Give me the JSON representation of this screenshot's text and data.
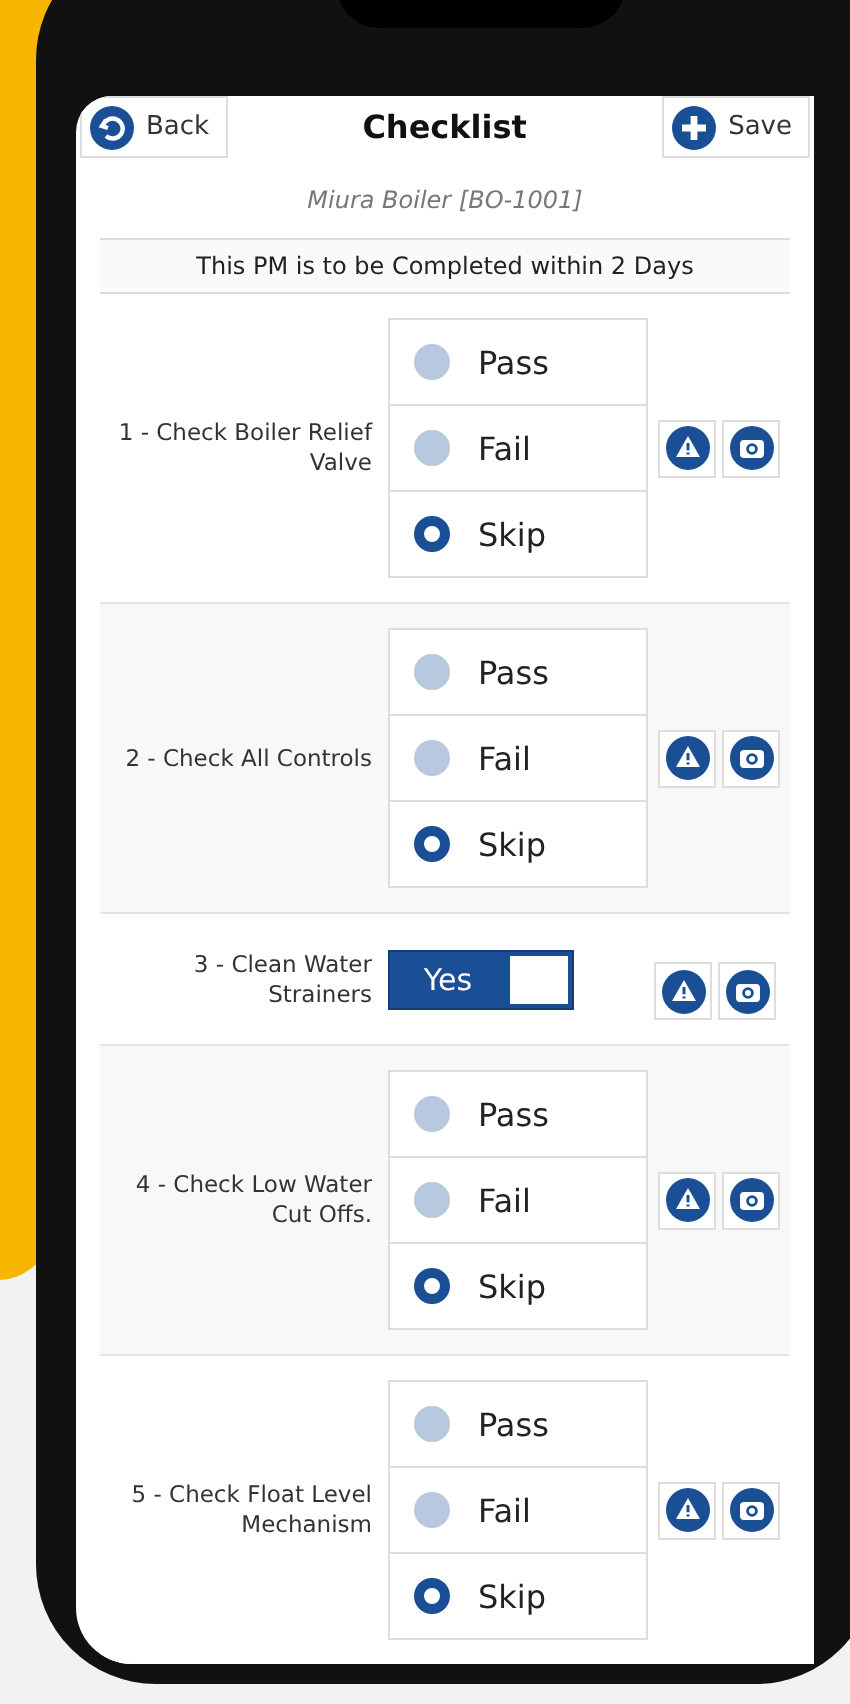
{
  "header": {
    "back": "Back",
    "title": "Checklist",
    "save": "Save"
  },
  "asset": "Miura Boiler [BO-1001]",
  "notice": "This PM is to be Completed within 2 Days",
  "items": [
    {
      "kind": "radio",
      "label": "1 - Check Boiler Relief Valve",
      "options": [
        {
          "label": "Pass",
          "selected": false
        },
        {
          "label": "Fail",
          "selected": false
        },
        {
          "label": "Skip",
          "selected": true
        }
      ]
    },
    {
      "kind": "radio",
      "label": "2 - Check All Controls",
      "options": [
        {
          "label": "Pass",
          "selected": false
        },
        {
          "label": "Fail",
          "selected": false
        },
        {
          "label": "Skip",
          "selected": true
        }
      ]
    },
    {
      "kind": "toggle",
      "label": "3 - Clean Water Strainers",
      "value": "Yes",
      "on": true
    },
    {
      "kind": "radio",
      "label": "4 - Check Low Water Cut Offs.",
      "options": [
        {
          "label": "Pass",
          "selected": false
        },
        {
          "label": "Fail",
          "selected": false
        },
        {
          "label": "Skip",
          "selected": true
        }
      ]
    },
    {
      "kind": "radio",
      "label": "5 - Check Float Level Mechanism",
      "options": [
        {
          "label": "Pass",
          "selected": false
        },
        {
          "label": "Fail",
          "selected": false
        },
        {
          "label": "Skip",
          "selected": true
        }
      ]
    }
  ]
}
